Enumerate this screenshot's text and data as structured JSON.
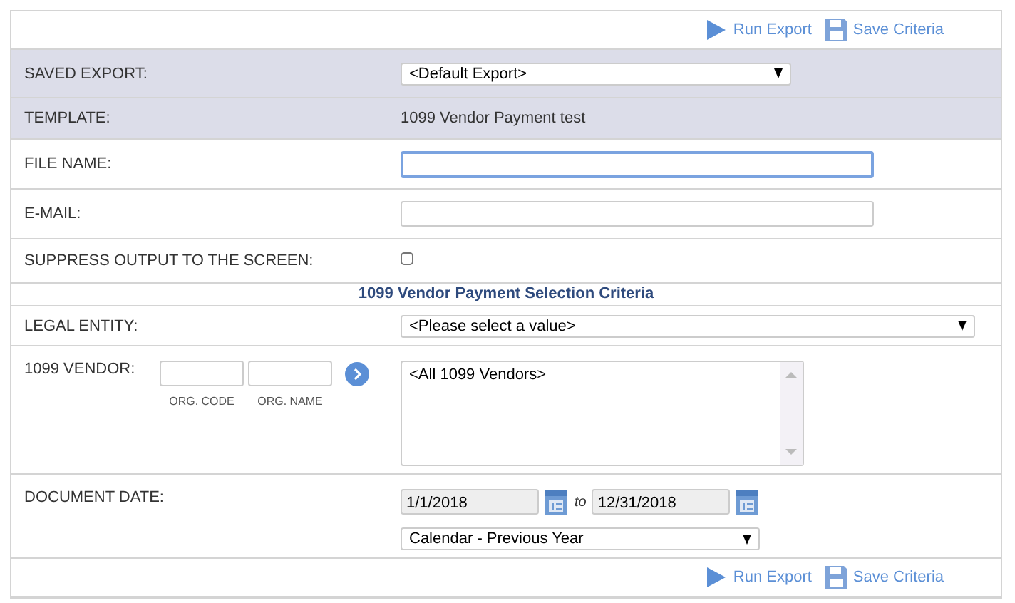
{
  "toolbar_top": {
    "run": "Run Export",
    "save": "Save Criteria"
  },
  "saved_export": {
    "label": "SAVED EXPORT:",
    "value": "<Default Export>"
  },
  "template": {
    "label": "TEMPLATE:",
    "value": "1099 Vendor Payment test"
  },
  "file_name": {
    "label": "FILE NAME:",
    "focused": true
  },
  "email": {
    "label": "E-MAIL:"
  },
  "suppress": {
    "label": "SUPPRESS OUTPUT TO THE SCREEN:",
    "checked": false
  },
  "section_title": "1099 Vendor Payment Selection Criteria",
  "legal_entity": {
    "label": "LEGAL ENTITY:",
    "value": "<Please select a value>"
  },
  "vendor": {
    "label": "1099 VENDOR:",
    "org_code": "ORG. CODE",
    "org_name": "ORG. NAME",
    "list": [
      "<All 1099 Vendors>"
    ]
  },
  "document_date": {
    "label": "DOCUMENT DATE:",
    "from": "1/1/2018",
    "to_word": "to",
    "to": "12/31/2018",
    "range": "Calendar - Previous Year"
  },
  "toolbar_bottom": {
    "run": "Run Export",
    "save": "Save Criteria"
  }
}
